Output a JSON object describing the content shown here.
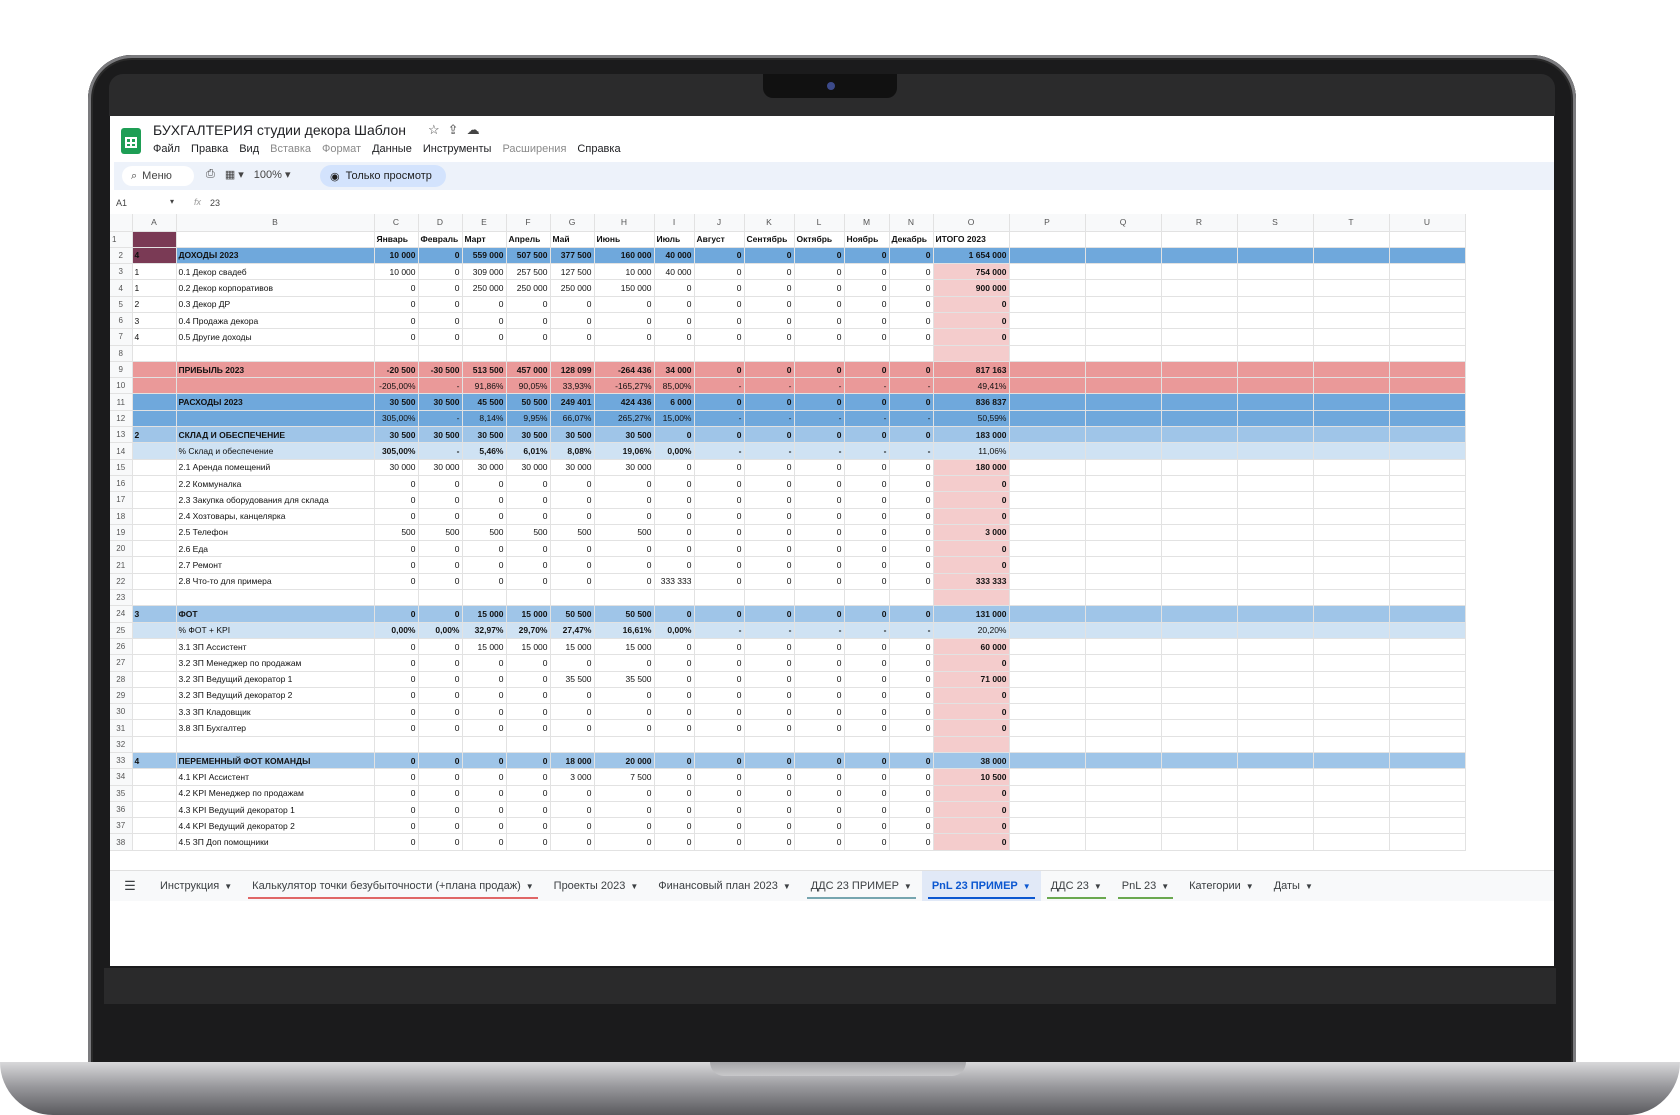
{
  "app": {
    "title": "БУХГАЛТЕРИЯ студии декора Шаблон",
    "menu": [
      "Файл",
      "Правка",
      "Вид",
      "Вставка",
      "Формат",
      "Данные",
      "Инструменты",
      "Расширения",
      "Справка"
    ],
    "menu_dim": [
      false,
      false,
      false,
      true,
      true,
      false,
      false,
      true,
      false
    ],
    "search_label": "Меню",
    "zoom": "100%",
    "view_mode": "Только просмотр"
  },
  "formula": {
    "cell_ref": "A1",
    "value": "23"
  },
  "columns": [
    "A",
    "B",
    "C",
    "D",
    "E",
    "F",
    "G",
    "H",
    "I",
    "J",
    "K",
    "L",
    "M",
    "N",
    "O",
    "P",
    "Q",
    "R",
    "S",
    "T",
    "U"
  ],
  "rows": [
    {
      "n": "1",
      "s": "hdr1",
      "a": "23",
      "b": "",
      "v": [
        "Январь",
        "Февраль",
        "Март",
        "Апрель",
        "Май",
        "Июнь",
        "Июль",
        "Август",
        "Сентябрь",
        "Октябрь",
        "Ноябрь",
        "Декабрь"
      ],
      "t": "ИТОГО 2023"
    },
    {
      "n": "2",
      "s": "inc",
      "a": "4",
      "b": "ДОХОДЫ 2023",
      "v": [
        "10 000",
        "0",
        "559 000",
        "507 500",
        "377 500",
        "160 000",
        "40 000",
        "0",
        "0",
        "0",
        "0",
        "0"
      ],
      "t": "1 654 000"
    },
    {
      "n": "3",
      "s": "",
      "a": "1",
      "b": "0.1 Декор свадеб",
      "v": [
        "10 000",
        "0",
        "309 000",
        "257 500",
        "127 500",
        "10 000",
        "40 000",
        "0",
        "0",
        "0",
        "0",
        "0"
      ],
      "t": "754 000"
    },
    {
      "n": "4",
      "s": "",
      "a": "1",
      "b": "0.2 Декор корпоративов",
      "v": [
        "0",
        "0",
        "250 000",
        "250 000",
        "250 000",
        "150 000",
        "0",
        "0",
        "0",
        "0",
        "0",
        "0"
      ],
      "t": "900 000"
    },
    {
      "n": "5",
      "s": "",
      "a": "2",
      "b": "0.3 Декор ДР",
      "v": [
        "0",
        "0",
        "0",
        "0",
        "0",
        "0",
        "0",
        "0",
        "0",
        "0",
        "0",
        "0"
      ],
      "t": "0"
    },
    {
      "n": "6",
      "s": "",
      "a": "3",
      "b": "0.4 Продажа декора",
      "v": [
        "0",
        "0",
        "0",
        "0",
        "0",
        "0",
        "0",
        "0",
        "0",
        "0",
        "0",
        "0"
      ],
      "t": "0"
    },
    {
      "n": "7",
      "s": "",
      "a": "4",
      "b": "0.5 Другие доходы",
      "v": [
        "0",
        "0",
        "0",
        "0",
        "0",
        "0",
        "0",
        "0",
        "0",
        "0",
        "0",
        "0"
      ],
      "t": "0"
    },
    {
      "n": "8",
      "s": "",
      "a": "",
      "b": "",
      "v": [
        "",
        "",
        "",
        "",
        "",
        "",
        "",
        "",
        "",
        "",
        "",
        ""
      ],
      "t": ""
    },
    {
      "n": "9",
      "s": "profit",
      "a": "",
      "b": "ПРИБЫЛЬ 2023",
      "v": [
        "-20 500",
        "-30 500",
        "513 500",
        "457 000",
        "128 099",
        "-264 436",
        "34 000",
        "0",
        "0",
        "0",
        "0",
        "0"
      ],
      "t": "817 163"
    },
    {
      "n": "10",
      "s": "profit2",
      "a": "",
      "b": "",
      "v": [
        "-205,00%",
        "-",
        "91,86%",
        "90,05%",
        "33,93%",
        "-165,27%",
        "85,00%",
        "-",
        "-",
        "-",
        "-",
        "-"
      ],
      "t": "49,41%"
    },
    {
      "n": "11",
      "s": "exp",
      "a": "",
      "b": "РАСХОДЫ 2023",
      "v": [
        "30 500",
        "30 500",
        "45 500",
        "50 500",
        "249 401",
        "424 436",
        "6 000",
        "0",
        "0",
        "0",
        "0",
        "0"
      ],
      "t": "836 837"
    },
    {
      "n": "12",
      "s": "exp2",
      "a": "",
      "b": "",
      "v": [
        "305,00%",
        "-",
        "8,14%",
        "9,95%",
        "66,07%",
        "265,27%",
        "15,00%",
        "-",
        "-",
        "-",
        "-",
        "-"
      ],
      "t": "50,59%"
    },
    {
      "n": "13",
      "s": "sec",
      "a": "2",
      "b": "СКЛАД И ОБЕСПЕЧЕНИЕ",
      "v": [
        "30 500",
        "30 500",
        "30 500",
        "30 500",
        "30 500",
        "30 500",
        "0",
        "0",
        "0",
        "0",
        "0",
        "0"
      ],
      "t": "183 000"
    },
    {
      "n": "14",
      "s": "pct",
      "a": "",
      "b": "% Склад и обеспечение",
      "v": [
        "305,00%",
        "-",
        "5,46%",
        "6,01%",
        "8,08%",
        "19,06%",
        "0,00%",
        "-",
        "-",
        "-",
        "-",
        "-"
      ],
      "t": "11,06%"
    },
    {
      "n": "15",
      "s": "",
      "a": "",
      "b": "2.1 Аренда помещений",
      "v": [
        "30 000",
        "30 000",
        "30 000",
        "30 000",
        "30 000",
        "30 000",
        "0",
        "0",
        "0",
        "0",
        "0",
        "0"
      ],
      "t": "180 000"
    },
    {
      "n": "16",
      "s": "",
      "a": "",
      "b": "2.2 Коммуналка",
      "v": [
        "0",
        "0",
        "0",
        "0",
        "0",
        "0",
        "0",
        "0",
        "0",
        "0",
        "0",
        "0"
      ],
      "t": "0"
    },
    {
      "n": "17",
      "s": "",
      "a": "",
      "b": "2.3 Закупка оборудования для склада",
      "v": [
        "0",
        "0",
        "0",
        "0",
        "0",
        "0",
        "0",
        "0",
        "0",
        "0",
        "0",
        "0"
      ],
      "t": "0"
    },
    {
      "n": "18",
      "s": "",
      "a": "",
      "b": "2.4 Хозтовары, канцелярка",
      "v": [
        "0",
        "0",
        "0",
        "0",
        "0",
        "0",
        "0",
        "0",
        "0",
        "0",
        "0",
        "0"
      ],
      "t": "0"
    },
    {
      "n": "19",
      "s": "",
      "a": "",
      "b": "2.5 Телефон",
      "v": [
        "500",
        "500",
        "500",
        "500",
        "500",
        "500",
        "0",
        "0",
        "0",
        "0",
        "0",
        "0"
      ],
      "t": "3 000"
    },
    {
      "n": "20",
      "s": "",
      "a": "",
      "b": "2.6 Еда",
      "v": [
        "0",
        "0",
        "0",
        "0",
        "0",
        "0",
        "0",
        "0",
        "0",
        "0",
        "0",
        "0"
      ],
      "t": "0"
    },
    {
      "n": "21",
      "s": "",
      "a": "",
      "b": "2.7 Ремонт",
      "v": [
        "0",
        "0",
        "0",
        "0",
        "0",
        "0",
        "0",
        "0",
        "0",
        "0",
        "0",
        "0"
      ],
      "t": "0"
    },
    {
      "n": "22",
      "s": "",
      "a": "",
      "b": "2.8 Что-то для примера",
      "v": [
        "0",
        "0",
        "0",
        "0",
        "0",
        "0",
        "333 333",
        "0",
        "0",
        "0",
        "0",
        "0"
      ],
      "t": "333 333"
    },
    {
      "n": "23",
      "s": "",
      "a": "",
      "b": "",
      "v": [
        "",
        "",
        "",
        "",
        "",
        "",
        "",
        "",
        "",
        "",
        "",
        ""
      ],
      "t": ""
    },
    {
      "n": "24",
      "s": "sec",
      "a": "3",
      "b": "ФОТ",
      "v": [
        "0",
        "0",
        "15 000",
        "15 000",
        "50 500",
        "50 500",
        "0",
        "0",
        "0",
        "0",
        "0",
        "0"
      ],
      "t": "131 000"
    },
    {
      "n": "25",
      "s": "pct",
      "a": "",
      "b": "% ФОТ + KPI",
      "v": [
        "0,00%",
        "0,00%",
        "32,97%",
        "29,70%",
        "27,47%",
        "16,61%",
        "0,00%",
        "-",
        "-",
        "-",
        "-",
        "-"
      ],
      "t": "20,20%"
    },
    {
      "n": "26",
      "s": "",
      "a": "",
      "b": "3.1 ЗП Ассистент",
      "v": [
        "0",
        "0",
        "15 000",
        "15 000",
        "15 000",
        "15 000",
        "0",
        "0",
        "0",
        "0",
        "0",
        "0"
      ],
      "t": "60 000"
    },
    {
      "n": "27",
      "s": "",
      "a": "",
      "b": "3.2 ЗП Менеджер по продажам",
      "v": [
        "0",
        "0",
        "0",
        "0",
        "0",
        "0",
        "0",
        "0",
        "0",
        "0",
        "0",
        "0"
      ],
      "t": "0"
    },
    {
      "n": "28",
      "s": "",
      "a": "",
      "b": "3.2 ЗП Ведущий декоратор 1",
      "v": [
        "0",
        "0",
        "0",
        "0",
        "35 500",
        "35 500",
        "0",
        "0",
        "0",
        "0",
        "0",
        "0"
      ],
      "t": "71 000"
    },
    {
      "n": "29",
      "s": "",
      "a": "",
      "b": "3.2 ЗП Ведущий декоратор 2",
      "v": [
        "0",
        "0",
        "0",
        "0",
        "0",
        "0",
        "0",
        "0",
        "0",
        "0",
        "0",
        "0"
      ],
      "t": "0"
    },
    {
      "n": "30",
      "s": "",
      "a": "",
      "b": "3.3 ЗП Кладовщик",
      "v": [
        "0",
        "0",
        "0",
        "0",
        "0",
        "0",
        "0",
        "0",
        "0",
        "0",
        "0",
        "0"
      ],
      "t": "0"
    },
    {
      "n": "31",
      "s": "",
      "a": "",
      "b": "3.8 ЗП Бухгалтер",
      "v": [
        "0",
        "0",
        "0",
        "0",
        "0",
        "0",
        "0",
        "0",
        "0",
        "0",
        "0",
        "0"
      ],
      "t": "0"
    },
    {
      "n": "32",
      "s": "",
      "a": "",
      "b": "",
      "v": [
        "",
        "",
        "",
        "",
        "",
        "",
        "",
        "",
        "",
        "",
        "",
        ""
      ],
      "t": ""
    },
    {
      "n": "33",
      "s": "sec",
      "a": "4",
      "b": "ПЕРЕМЕННЫЙ ФОТ КОМАНДЫ",
      "v": [
        "0",
        "0",
        "0",
        "0",
        "18 000",
        "20 000",
        "0",
        "0",
        "0",
        "0",
        "0",
        "0"
      ],
      "t": "38 000"
    },
    {
      "n": "34",
      "s": "",
      "a": "",
      "b": "4.1 KPI Ассистент",
      "v": [
        "0",
        "0",
        "0",
        "0",
        "3 000",
        "7 500",
        "0",
        "0",
        "0",
        "0",
        "0",
        "0"
      ],
      "t": "10 500"
    },
    {
      "n": "35",
      "s": "",
      "a": "",
      "b": "4.2 KPI Менеджер по продажам",
      "v": [
        "0",
        "0",
        "0",
        "0",
        "0",
        "0",
        "0",
        "0",
        "0",
        "0",
        "0",
        "0"
      ],
      "t": "0"
    },
    {
      "n": "36",
      "s": "",
      "a": "",
      "b": "4.3 KPI Ведущий декоратор 1",
      "v": [
        "0",
        "0",
        "0",
        "0",
        "0",
        "0",
        "0",
        "0",
        "0",
        "0",
        "0",
        "0"
      ],
      "t": "0"
    },
    {
      "n": "37",
      "s": "",
      "a": "",
      "b": "4.4 KPI Ведущий декоратор 2",
      "v": [
        "0",
        "0",
        "0",
        "0",
        "0",
        "0",
        "0",
        "0",
        "0",
        "0",
        "0",
        "0"
      ],
      "t": "0"
    },
    {
      "n": "38",
      "s": "",
      "a": "",
      "b": "4.5 ЗП Доп помощники",
      "v": [
        "0",
        "0",
        "0",
        "0",
        "0",
        "0",
        "0",
        "0",
        "0",
        "0",
        "0",
        "0"
      ],
      "t": "0"
    }
  ],
  "tabs": [
    {
      "label": "Инструкция",
      "active": false,
      "color": ""
    },
    {
      "label": "Калькулятор точки безубыточности (+плана продаж)",
      "active": false,
      "color": "#e06666"
    },
    {
      "label": "Проекты 2023",
      "active": false,
      "color": ""
    },
    {
      "label": "Финансовый план 2023",
      "active": false,
      "color": ""
    },
    {
      "label": "ДДС 23 ПРИМЕР",
      "active": false,
      "color": "#76a5af"
    },
    {
      "label": "PnL 23 ПРИМЕР",
      "active": true,
      "color": "#0b57d0"
    },
    {
      "label": "ДДС 23",
      "active": false,
      "color": "#6aa84f"
    },
    {
      "label": "PnL 23",
      "active": false,
      "color": "#6aa84f"
    },
    {
      "label": "Категории",
      "active": false,
      "color": ""
    },
    {
      "label": "Даты",
      "active": false,
      "color": ""
    }
  ]
}
